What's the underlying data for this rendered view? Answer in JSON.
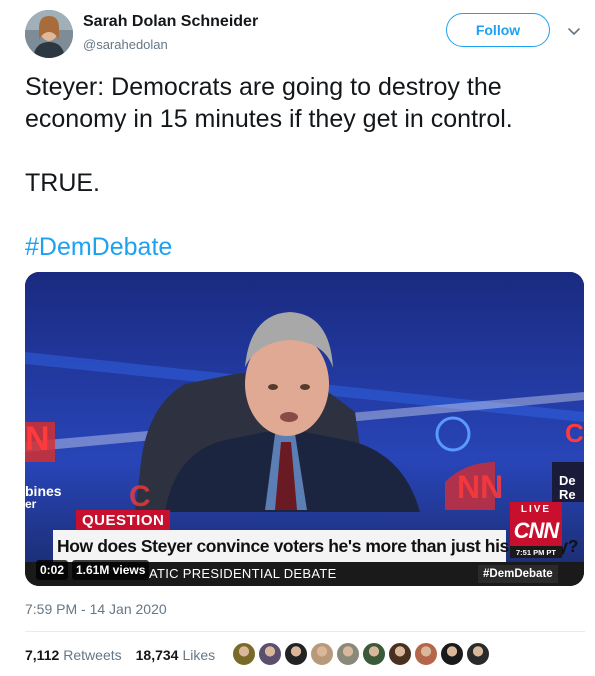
{
  "user": {
    "name": "Sarah Dolan Schneider",
    "handle": "@sarahedolan"
  },
  "follow_label": "Follow",
  "tweet": {
    "line1": "Steyer: Democrats are going to destroy the",
    "line2": "economy in 15 minutes if they get in control.",
    "line3": "TRUE.",
    "hashtag": "#DemDebate"
  },
  "media": {
    "chyron_tag": "QUESTION",
    "chyron_main": "How does Steyer convince voters he's more than just his money?",
    "chyron_sub": "ATIC PRESIDENTIAL DEBATE",
    "chyron_hashtag": "#DemDebate",
    "live_label": "LIVE",
    "network": "CNN",
    "live_time": "7:51 PM PT",
    "video_time": "0:02",
    "video_views": "1.61M views"
  },
  "timestamp": "7:59 PM - 14 Jan 2020",
  "stats": {
    "retweets_count": "7,112",
    "retweets_label": "Retweets",
    "likes_count": "18,734",
    "likes_label": "Likes"
  },
  "likers": [
    {
      "color": "#7a6a2a"
    },
    {
      "color": "#5b4f6e"
    },
    {
      "color": "#222222"
    },
    {
      "color": "#b89a7a"
    },
    {
      "color": "#8a8a7a"
    },
    {
      "color": "#3a5a3a"
    },
    {
      "color": "#4a3020"
    },
    {
      "color": "#b5654a"
    },
    {
      "color": "#1a1a1a"
    },
    {
      "color": "#2a2a2a"
    }
  ],
  "colors": {
    "accent": "#1da1f2",
    "text": "#14171a",
    "muted": "#657786",
    "cnn_red": "#c8102e"
  }
}
